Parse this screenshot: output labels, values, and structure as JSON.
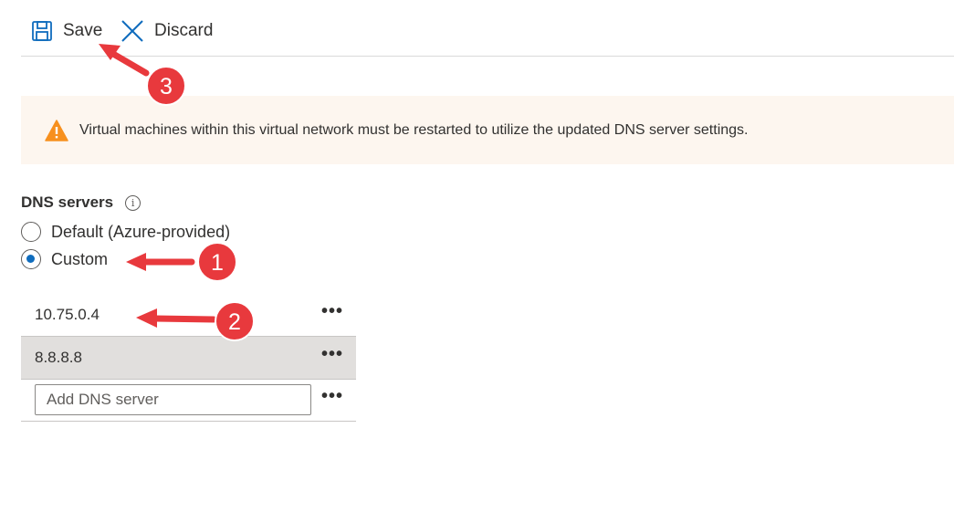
{
  "toolbar": {
    "save_label": "Save",
    "discard_label": "Discard"
  },
  "banner": {
    "message": "Virtual machines within this virtual network must be restarted to utilize the updated DNS server settings.",
    "icon": "warning-icon"
  },
  "dns": {
    "title": "DNS servers",
    "info_icon": "info-icon",
    "options": [
      {
        "label": "Default (Azure-provided)",
        "selected": false
      },
      {
        "label": "Custom",
        "selected": true
      }
    ],
    "servers": [
      "10.75.0.4",
      "8.8.8.8"
    ],
    "add_placeholder": "Add DNS server",
    "more_label": "•••"
  },
  "callouts": {
    "numbers": [
      "1",
      "2",
      "3"
    ],
    "color": "#e8393d"
  },
  "colors": {
    "accent": "#0f6cbd",
    "warning": "#f7901e",
    "banner_bg": "#fdf6ef",
    "selected_row_bg": "#e1dfdd"
  }
}
